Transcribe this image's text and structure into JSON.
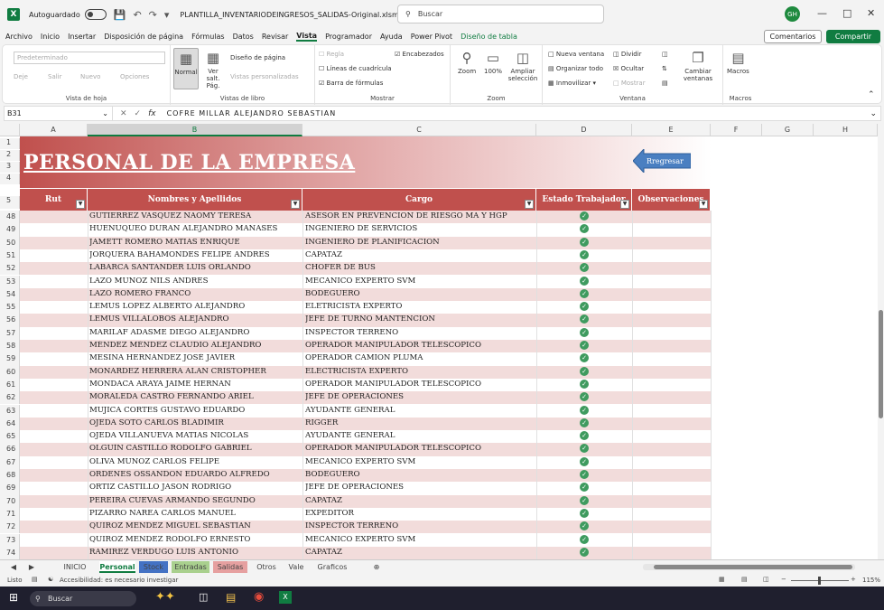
{
  "titlebar": {
    "autosave_label": "Autoguardado",
    "filename": "PLANTILLA_INVENTARIODEINGRESOS_SALIDAS-Original.xlsm • E...",
    "search_placeholder": "Buscar",
    "avatar": "GH"
  },
  "menu": [
    "Archivo",
    "Inicio",
    "Insertar",
    "Disposición de página",
    "Fórmulas",
    "Datos",
    "Revisar",
    "Vista",
    "Programador",
    "Ayuda",
    "Power Pivot",
    "Diseño de tabla"
  ],
  "menu_active": "Vista",
  "actions": {
    "comments": "Comentarios",
    "share": "Compartir"
  },
  "ribbon": {
    "sheet_view": {
      "dropdown": "Predeterminado",
      "keep": "Deje",
      "exit": "Salir",
      "new": "Nuevo",
      "options": "Opciones",
      "label": "Vista de hoja"
    },
    "workbook_views": {
      "normal": "Normal",
      "page_break": "Ver salt. Pág.",
      "page_layout": "Diseño de página",
      "custom": "Vistas personalizadas",
      "label": "Vistas de libro"
    },
    "show": {
      "ruler": "Regla",
      "gridlines": "Líneas de cuadrícula",
      "formula_bar": "Barra de fórmulas",
      "headings": "Encabezados",
      "label": "Mostrar"
    },
    "zoom": {
      "zoom": "Zoom",
      "pct100": "100%",
      "selection": "Ampliar selección",
      "label": "Zoom"
    },
    "window": {
      "new_window": "Nueva ventana",
      "arrange": "Organizar todo",
      "freeze": "Inmovilizar",
      "split": "Dividir",
      "hide": "Ocultar",
      "show": "Mostrar",
      "switch": "Cambiar ventanas",
      "label": "Ventana"
    },
    "macros": {
      "macros": "Macros",
      "label": "Macros"
    }
  },
  "formula": {
    "cell": "B31",
    "fx": "fx",
    "content": "COFRE MILLAR ALEJANDRO SEBASTIAN"
  },
  "columns": [
    "A",
    "B",
    "C",
    "D",
    "E",
    "F",
    "G",
    "H"
  ],
  "banner": {
    "title": "PERSONAL DE LA EMPRESA",
    "back_button": "Rregresar"
  },
  "table_headers": [
    "Rut",
    "Nombres y Apellidos",
    "Cargo",
    "Estado Trabajador",
    "Observaciones"
  ],
  "header_rows": [
    "1",
    "2",
    "3",
    "4",
    "5"
  ],
  "rows": [
    {
      "n": "48",
      "name": "GUTIERREZ VASQUEZ NAOMY TERESA",
      "job": "ASESOR EN PREVENCION DE RIESGO MA Y HGP"
    },
    {
      "n": "49",
      "name": "HUENUQUEO DURAN ALEJANDRO MANASES",
      "job": "INGENIERO DE SERVICIOS"
    },
    {
      "n": "50",
      "name": "JAMETT ROMERO MATIAS ENRIQUE",
      "job": "INGENIERO DE PLANIFICACION"
    },
    {
      "n": "51",
      "name": "JORQUERA BAHAMONDES FELIPE ANDRES",
      "job": "CAPATAZ"
    },
    {
      "n": "52",
      "name": "LABARCA SANTANDER LUIS ORLANDO",
      "job": "CHOFER DE BUS"
    },
    {
      "n": "53",
      "name": "LAZO MUÑOZ NILS ANDRES",
      "job": "MECANICO EXPERTO SVM"
    },
    {
      "n": "54",
      "name": "LAZO ROMERO FRANCO",
      "job": "BODEGUERO"
    },
    {
      "n": "55",
      "name": "LEMUS LOPEZ ALBERTO ALEJANDRO",
      "job": "ELETRICISTA EXPERTO"
    },
    {
      "n": "56",
      "name": "LEMUS VILLALOBOS ALEJANDRO",
      "job": "JEFE DE TURNO MANTENCION"
    },
    {
      "n": "57",
      "name": "MARILAF ADASME DIEGO ALEJANDRO",
      "job": "INSPECTOR TERRENO"
    },
    {
      "n": "58",
      "name": "MÉNDEZ MÉNDEZ CLAUDIO ALEJANDRO",
      "job": "OPERADOR MANIPULADOR TELESCOPICO"
    },
    {
      "n": "59",
      "name": "MESINA HERNÁNDEZ JOSÉ JAVIER",
      "job": "OPERADOR CAMION PLUMA"
    },
    {
      "n": "60",
      "name": "MONARDEZ HERRERA ALAN CRISTOPHER",
      "job": "ELECTRICISTA EXPERTO"
    },
    {
      "n": "61",
      "name": "MONDACA ARAYA JAIME HERNAN",
      "job": "OPERADOR MANIPULADOR TELESCOPICO"
    },
    {
      "n": "62",
      "name": "MORALEDA CASTRO FERNANDO ARIEL",
      "job": "JEFE DE OPERACIONES"
    },
    {
      "n": "63",
      "name": "MUJICA CORTES GUSTAVO EDUARDO",
      "job": "AYUDANTE GENERAL"
    },
    {
      "n": "64",
      "name": "OJEDA SOTO CARLOS BLADIMIR",
      "job": "RIGGER"
    },
    {
      "n": "65",
      "name": "OJEDA VILLANUEVA MATIAS NICOLAS",
      "job": "AYUDANTE GENERAL"
    },
    {
      "n": "66",
      "name": "OLGUÍN CASTILLO RODOLFO GABRIEL",
      "job": "OPERADOR MANIPULADOR TELESCOPICO"
    },
    {
      "n": "67",
      "name": "OLIVA MUÑOZ CARLOS FELIPE",
      "job": "MECANICO EXPERTO SVM"
    },
    {
      "n": "68",
      "name": "ORDENES OSSANDON EDUARDO ALFREDO",
      "job": "BODEGUERO"
    },
    {
      "n": "69",
      "name": "ORTIZ CASTILLO JASON RODRIGO",
      "job": "JEFE DE OPERACIONES"
    },
    {
      "n": "70",
      "name": "PEREIRA CUEVAS ARMANDO SEGUNDO",
      "job": "CAPATAZ"
    },
    {
      "n": "71",
      "name": "PIZARRO NAREA CARLOS MANUEL",
      "job": "EXPEDITOR"
    },
    {
      "n": "72",
      "name": "QUIROZ MENDEZ MIGUEL SEBASTIAN",
      "job": "INSPECTOR TERRENO"
    },
    {
      "n": "73",
      "name": "QUIROZ MENDEZ RODOLFO ERNESTO",
      "job": "MECANICO EXPERTO SVM"
    },
    {
      "n": "74",
      "name": "RAMIREZ VERDUGO LUIS ANTONIO",
      "job": "CAPATAZ"
    }
  ],
  "sheets": [
    {
      "name": "INICIO",
      "color": ""
    },
    {
      "name": "Personal",
      "color": "#ffffff"
    },
    {
      "name": "Stock",
      "color": "#4472c4"
    },
    {
      "name": "Entradas",
      "color": "#a9d08e"
    },
    {
      "name": "Salidas",
      "color": "#e6a0a0"
    },
    {
      "name": "Otros",
      "color": ""
    },
    {
      "name": "Vale",
      "color": ""
    },
    {
      "name": "Graficos",
      "color": ""
    }
  ],
  "status": {
    "ready": "Listo",
    "accessibility": "Accesibilidad: es necesario investigar",
    "zoom": "115%"
  },
  "taskbar": {
    "search": "Buscar"
  },
  "colors": {
    "header_red": "#c0504d",
    "band_pink": "#f2dcdb",
    "excel_green": "#107c41",
    "check_green": "#3f9b5f"
  }
}
